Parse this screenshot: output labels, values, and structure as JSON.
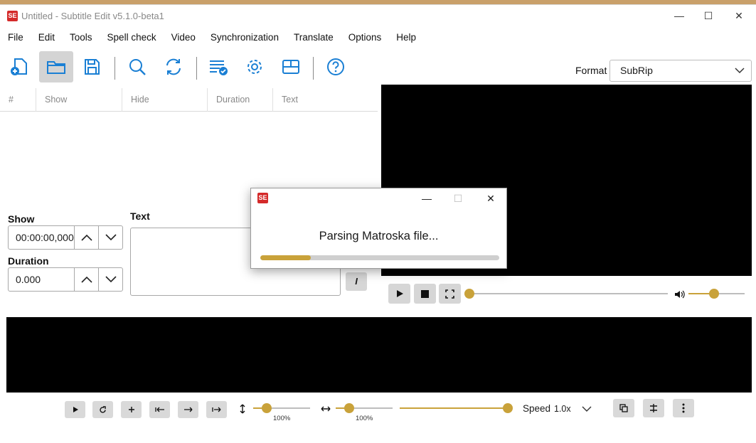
{
  "window": {
    "title": "Untitled - Subtitle Edit v5.1.0-beta1",
    "logo_text": "SE",
    "minimize": "—",
    "maximize": "☐",
    "close": "✕"
  },
  "menu": [
    "File",
    "Edit",
    "Tools",
    "Spell check",
    "Video",
    "Synchronization",
    "Translate",
    "Options",
    "Help"
  ],
  "toolbar": {
    "icons": [
      "new-file-icon",
      "open-folder-icon",
      "save-icon",
      "search-icon",
      "replace-icon",
      "spell-check-icon",
      "settings-icon",
      "layout-icon",
      "help-icon"
    ],
    "active": "open-folder-icon",
    "format_label": "Format",
    "format_value": "SubRip"
  },
  "grid": {
    "columns": [
      "#",
      "Show",
      "Hide",
      "Duration",
      "Text"
    ]
  },
  "editor": {
    "show_label": "Show",
    "show_value": "00:00:00,000",
    "duration_label": "Duration",
    "duration_value": "0.000",
    "text_label": "Text",
    "italic_label": "I"
  },
  "video_player": {
    "position_fraction": 0.0,
    "volume_fraction": 0.45
  },
  "waveform_controls": {
    "vertical_zoom_label": "100%",
    "horizontal_zoom_label": "100%",
    "speed_label": "Speed",
    "speed_value": "1.0x"
  },
  "dialog": {
    "logo_text": "SE",
    "message": "Parsing Matroska file...",
    "progress_fraction": 0.21
  },
  "colors": {
    "accent": "#c9a23a",
    "icon_blue": "#1a7fd4",
    "logo_red": "#d42a2a"
  }
}
